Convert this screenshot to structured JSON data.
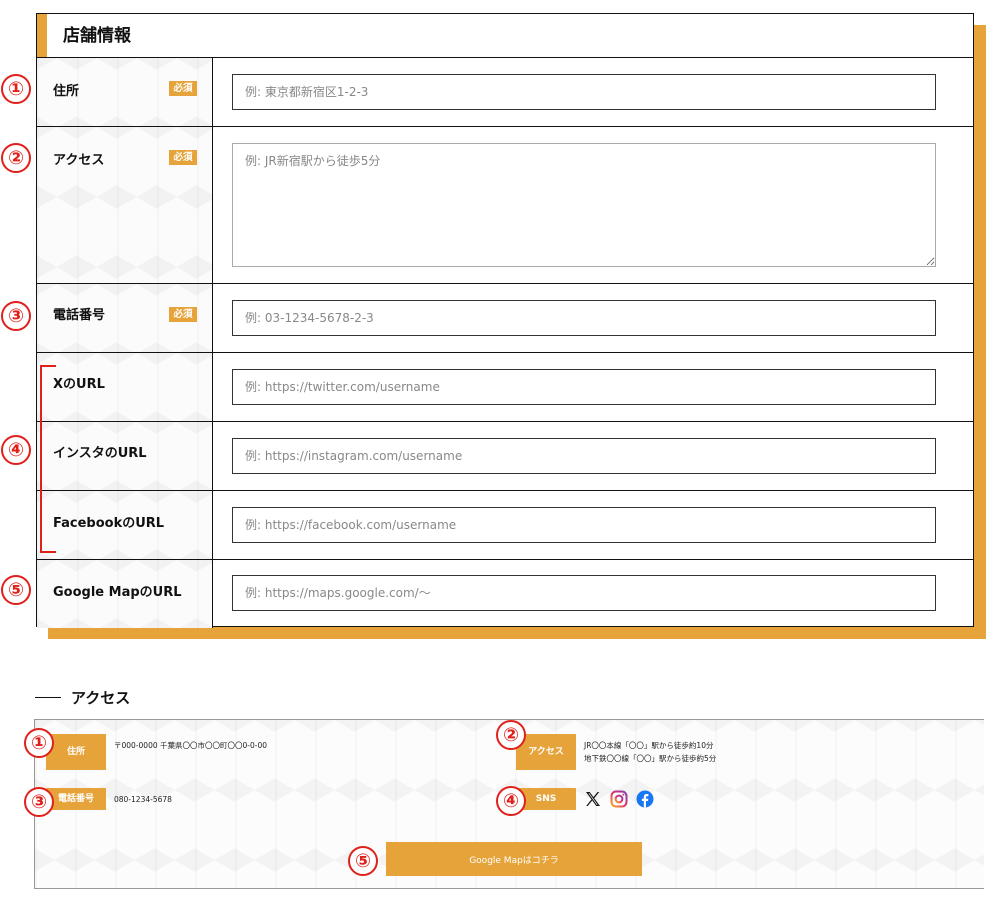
{
  "form": {
    "title": "店舗情報",
    "required_label": "必須",
    "fields": [
      {
        "label": "住所",
        "placeholder": "例: 東京都新宿区1-2-3",
        "required": true
      },
      {
        "label": "アクセス",
        "placeholder": "例: JR新宿駅から徒歩5分",
        "required": true
      },
      {
        "label": "電話番号",
        "placeholder": "例: 03-1234-5678-2-3",
        "required": true
      },
      {
        "label": "XのURL",
        "placeholder": "例: https://twitter.com/username",
        "required": false
      },
      {
        "label": "インスタのURL",
        "placeholder": "例: https://instagram.com/username",
        "required": false
      },
      {
        "label": "FacebookのURL",
        "placeholder": "例: https://facebook.com/username",
        "required": false
      },
      {
        "label": "Google MapのURL",
        "placeholder": "例: https://maps.google.com/〜",
        "required": false
      }
    ]
  },
  "markers": [
    "①",
    "②",
    "③",
    "④",
    "⑤"
  ],
  "access": {
    "heading": "アクセス",
    "address_label": "住所",
    "address_value": "〒000-0000 千葉県〇〇市〇〇町〇〇0-0-00",
    "access_label": "アクセス",
    "access_lines": [
      "JR〇〇本線「〇〇」駅から徒歩約10分",
      "地下鉄〇〇線「〇〇」駅から徒歩約5分"
    ],
    "phone_label": "電話番号",
    "phone_value": "080-1234-5678",
    "sns_label": "SNS",
    "sns_icons": [
      "x-icon",
      "instagram-icon",
      "facebook-icon"
    ],
    "map_button": "Google Mapはコチラ"
  },
  "colors": {
    "accent": "#e6a33a",
    "marker": "#e0201b",
    "facebook": "#1877f2"
  }
}
